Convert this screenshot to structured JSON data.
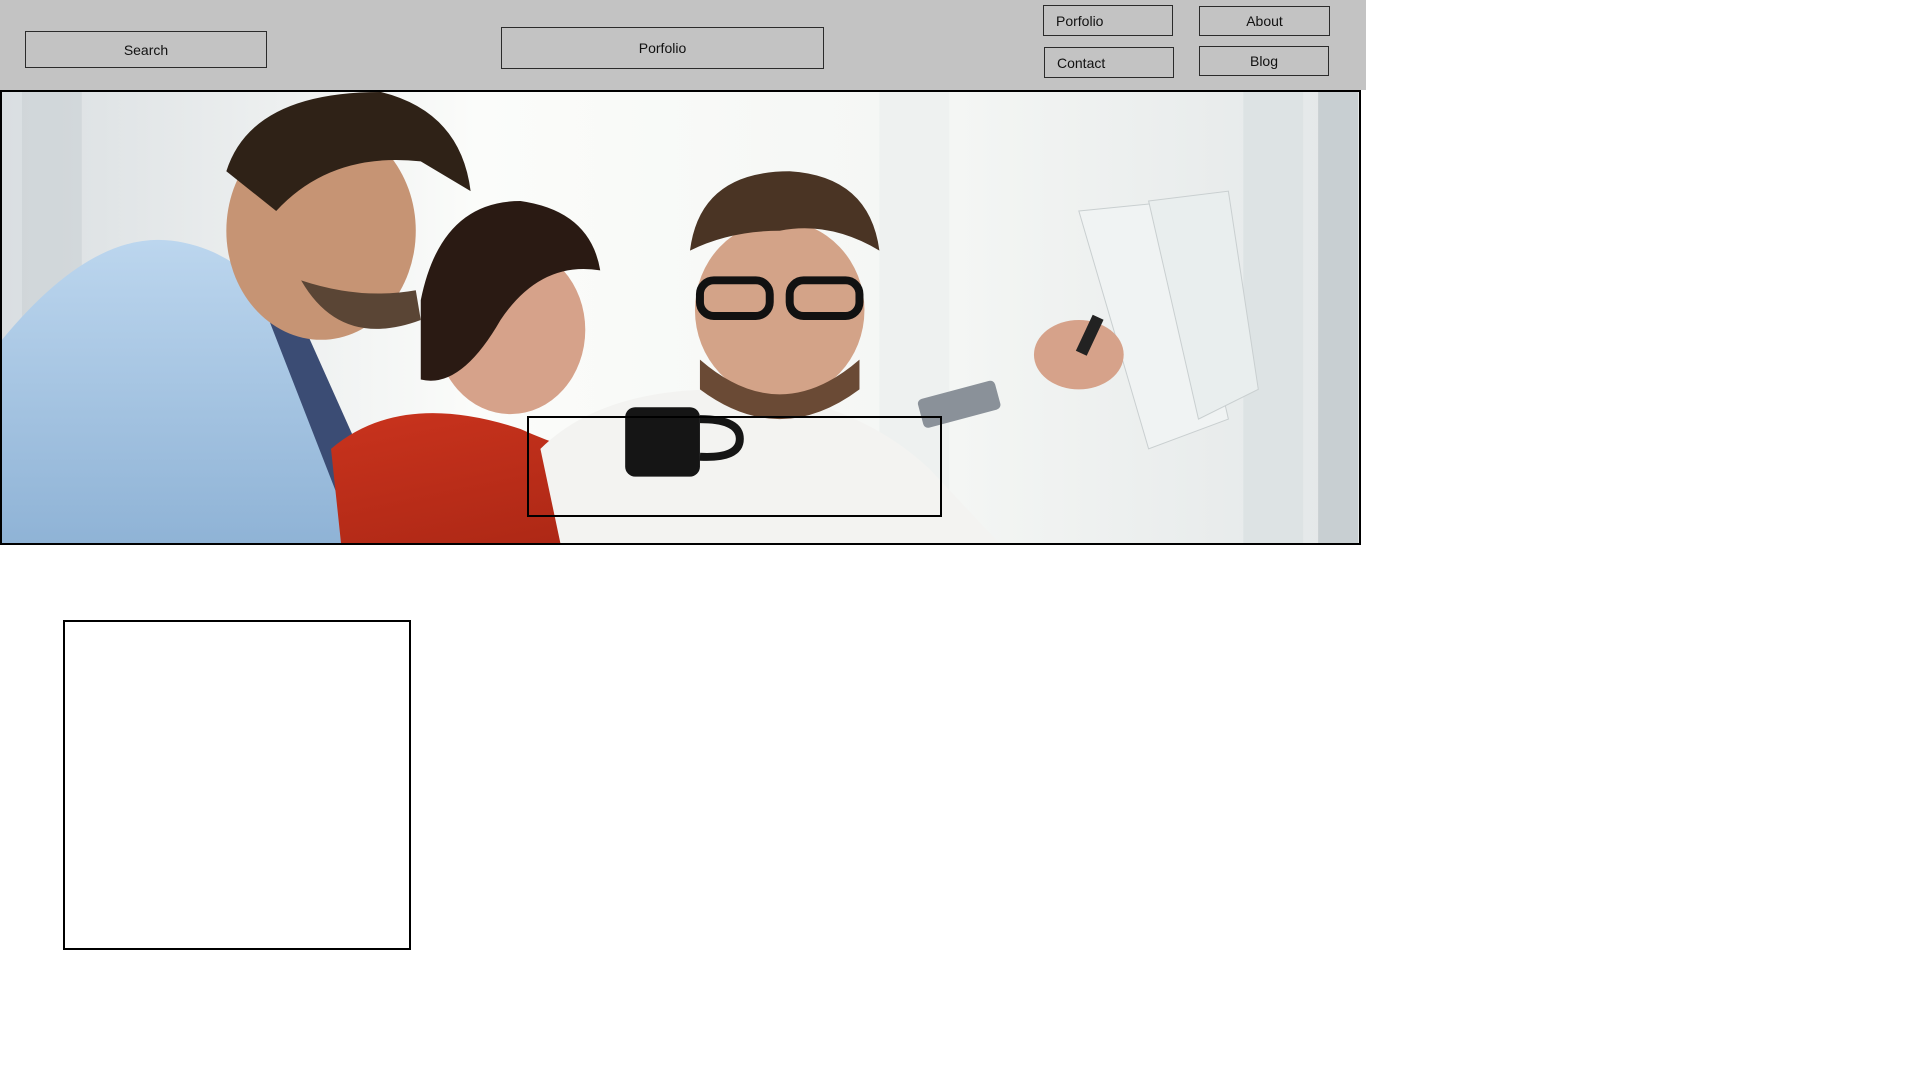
{
  "header": {
    "search_label": "Search",
    "portfolio_center_label": "Porfolio",
    "nav": {
      "portfolio_label": "Porfolio",
      "contact_label": "Contact",
      "about_label": "About",
      "blog_label": "Blog"
    },
    "background_color": "#c3c3c3"
  },
  "hero": {
    "image_subject": "team-meeting-photo"
  }
}
